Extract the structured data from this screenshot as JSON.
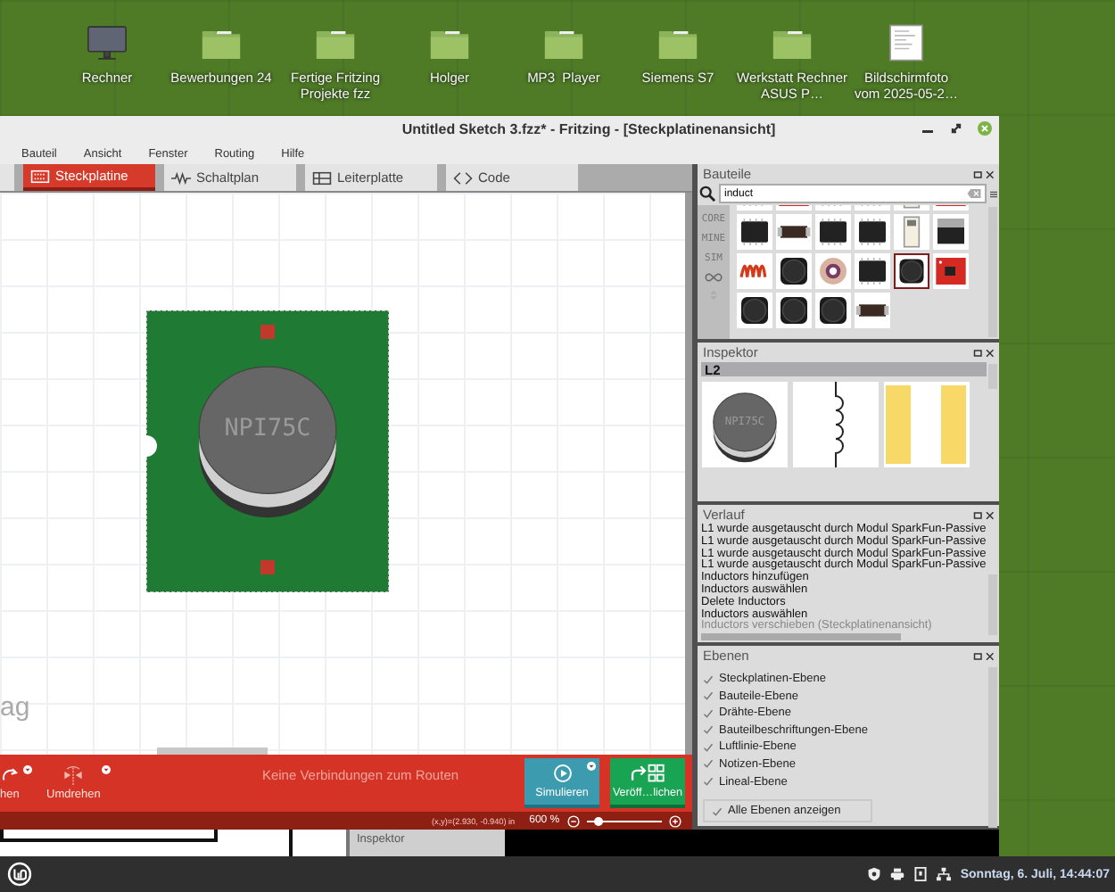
{
  "desktop": {
    "icons": [
      {
        "label": "Rechner",
        "kind": "computer"
      },
      {
        "label": "Bewerbungen 24",
        "kind": "folder"
      },
      {
        "label": "Fertige Fritzing Projekte fzz",
        "kind": "folder"
      },
      {
        "label": "Holger",
        "kind": "folder"
      },
      {
        "label": "MP3  Player",
        "kind": "folder"
      },
      {
        "label": "Siemens S7",
        "kind": "folder"
      },
      {
        "label": "Werkstatt Rechner ASUS P…",
        "kind": "folder"
      },
      {
        "label": "Bildschirmfoto vom 2025-05-2…",
        "kind": "image"
      }
    ]
  },
  "window": {
    "title": "Untitled Sketch 3.fzz* - Fritzing - [Steckplatinenansicht]",
    "menu": [
      "Bauteil",
      "Ansicht",
      "Fenster",
      "Routing",
      "Hilfe"
    ],
    "tabs": [
      {
        "label": "Steckplatine",
        "kind": "breadboard",
        "selected": true
      },
      {
        "label": "Schaltplan",
        "kind": "schematic",
        "selected": false
      },
      {
        "label": "Leiterplatte",
        "kind": "pcb",
        "selected": false
      },
      {
        "label": "Code",
        "kind": "code",
        "selected": false
      }
    ],
    "canvas": {
      "part_label": "NPI75C",
      "text_fragment": "ag"
    },
    "toolbar": {
      "buttons": [
        {
          "label": "hen",
          "kind": "rotate"
        },
        {
          "label": "Umdrehen",
          "kind": "flip"
        }
      ],
      "message": "Keine Verbindungen zum Routen",
      "simulate": "Simulieren",
      "publish": "Veröff…lichen"
    },
    "status": {
      "coordinates": "(x,y)=(2.930, -0.940) in",
      "zoom": "600 %",
      "zoom_slider": {
        "level": 0.15
      }
    },
    "bottom_panel": {
      "title": "Inspektor"
    }
  },
  "parts_panel": {
    "title": "Bauteile",
    "search": "induct",
    "bins": [
      "CORE",
      "MINE",
      "SIM"
    ],
    "parts": [
      {
        "kind": "ic",
        "selected": false
      },
      {
        "kind": "board",
        "selected": false
      },
      {
        "kind": "ic",
        "selected": false
      },
      {
        "kind": "ic",
        "selected": false
      },
      {
        "kind": "header",
        "selected": false
      },
      {
        "kind": "board",
        "selected": false
      },
      {
        "kind": "ic",
        "selected": false
      },
      {
        "kind": "smd",
        "selected": false
      },
      {
        "kind": "ic",
        "selected": false
      },
      {
        "kind": "ic",
        "selected": false
      },
      {
        "kind": "header",
        "selected": false
      },
      {
        "kind": "regulator",
        "selected": false
      },
      {
        "kind": "coil",
        "selected": false
      },
      {
        "kind": "inductor",
        "selected": false
      },
      {
        "kind": "toroid",
        "selected": false
      },
      {
        "kind": "ic",
        "selected": false
      },
      {
        "kind": "inductor",
        "selected": true
      },
      {
        "kind": "board",
        "selected": false
      },
      {
        "kind": "inductor",
        "selected": false
      },
      {
        "kind": "inductor",
        "selected": false
      },
      {
        "kind": "inductor",
        "selected": false
      },
      {
        "kind": "smd",
        "selected": false
      }
    ]
  },
  "inspector": {
    "title": "Inspektor",
    "part": "L2",
    "image_label": "NPI75C"
  },
  "history": {
    "title": "Verlauf",
    "entries": [
      {
        "text": "L1 wurde ausgetauscht durch Modul SparkFun-Passive",
        "current": false
      },
      {
        "text": "L1 wurde ausgetauscht durch Modul SparkFun-Passive",
        "current": false
      },
      {
        "text": "L1 wurde ausgetauscht durch Modul SparkFun-Passive",
        "current": false
      },
      {
        "text": "L1 wurde ausgetauscht durch Modul SparkFun-Passive",
        "current": false
      },
      {
        "text": "Inductors hinzufügen",
        "current": false
      },
      {
        "text": "Inductors auswählen",
        "current": false
      },
      {
        "text": "Delete Inductors",
        "current": false
      },
      {
        "text": "Inductors auswählen",
        "current": false
      },
      {
        "text": "Inductors verschieben (Steckplatinenansicht)",
        "current": true
      }
    ]
  },
  "layers": {
    "title": "Ebenen",
    "items": [
      {
        "label": "Steckplatinen-Ebene",
        "checked": true
      },
      {
        "label": "Bauteile-Ebene",
        "checked": true
      },
      {
        "label": "Drähte-Ebene",
        "checked": true
      },
      {
        "label": "Bauteilbeschriftungen-Ebene",
        "checked": true
      },
      {
        "label": "Luftlinie-Ebene",
        "checked": true
      },
      {
        "label": "Notizen-Ebene",
        "checked": true
      },
      {
        "label": "Lineal-Ebene",
        "checked": true
      }
    ],
    "show_all": {
      "label": "Alle Ebenen anzeigen",
      "checked": true
    }
  },
  "taskbar": {
    "clock": "Sonntag, 6. Juli, 14:44:07"
  }
}
